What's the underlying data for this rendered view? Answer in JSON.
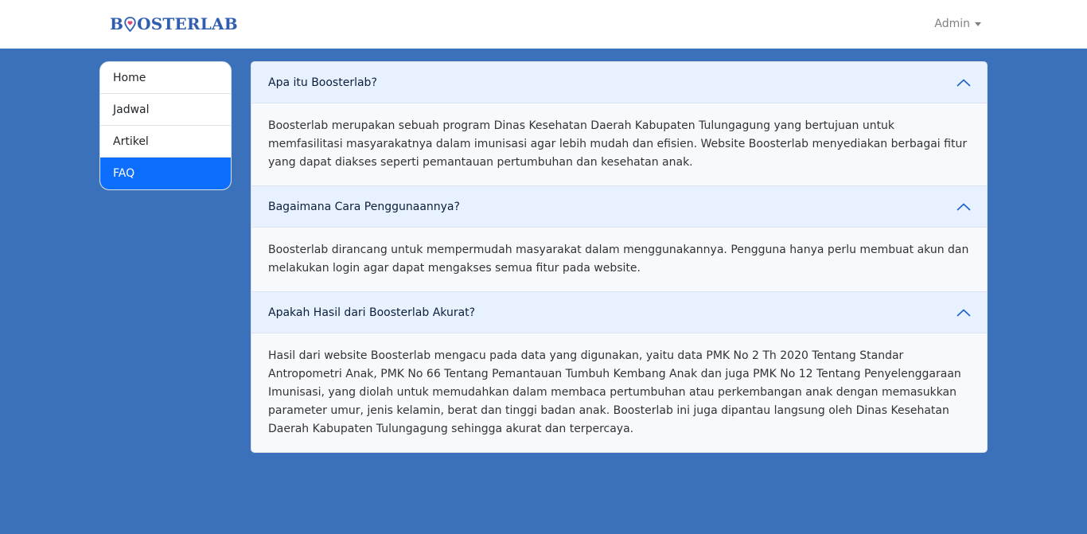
{
  "navbar": {
    "brand_prefix": "B",
    "brand_suffix": "OSTERLAB",
    "user_label": "Admin"
  },
  "colors": {
    "page_bg": "#3b71ba",
    "accent": "#0d6efd",
    "header_bg": "#e7f1ff"
  },
  "sidebar": {
    "items": [
      {
        "label": "Home",
        "active": false
      },
      {
        "label": "Jadwal",
        "active": false
      },
      {
        "label": "Artikel",
        "active": false
      },
      {
        "label": "FAQ",
        "active": true
      }
    ]
  },
  "faq": {
    "items": [
      {
        "question": "Apa itu Boosterlab?",
        "expanded": true,
        "answer": "Boosterlab merupakan sebuah program Dinas Kesehatan Daerah Kabupaten Tulungagung yang bertujuan untuk memfasilitasi masyarakatnya dalam imunisasi agar lebih mudah dan efisien. Website Boosterlab menyediakan berbagai fitur yang dapat diakses seperti pemantauan pertumbuhan dan kesehatan anak."
      },
      {
        "question": "Bagaimana Cara Penggunaannya?",
        "expanded": true,
        "answer": "Boosterlab dirancang untuk mempermudah masyarakat dalam menggunakannya. Pengguna hanya perlu membuat akun dan melakukan login agar dapat mengakses semua fitur pada website."
      },
      {
        "question": "Apakah Hasil dari Boosterlab Akurat?",
        "expanded": true,
        "answer": "Hasil dari website Boosterlab mengacu pada data yang digunakan, yaitu data PMK No 2 Th 2020 Tentang Standar Antropometri Anak, PMK No 66 Tentang Pemantauan Tumbuh Kembang Anak dan juga PMK No 12 Tentang Penyelenggaraan Imunisasi, yang diolah untuk memudahkan dalam membaca pertumbuhan atau perkembangan anak dengan memasukkan parameter umur, jenis kelamin, berat dan tinggi badan anak. Boosterlab ini juga dipantau langsung oleh Dinas Kesehatan Daerah Kabupaten Tulungagung sehingga akurat dan terpercaya."
      }
    ]
  }
}
